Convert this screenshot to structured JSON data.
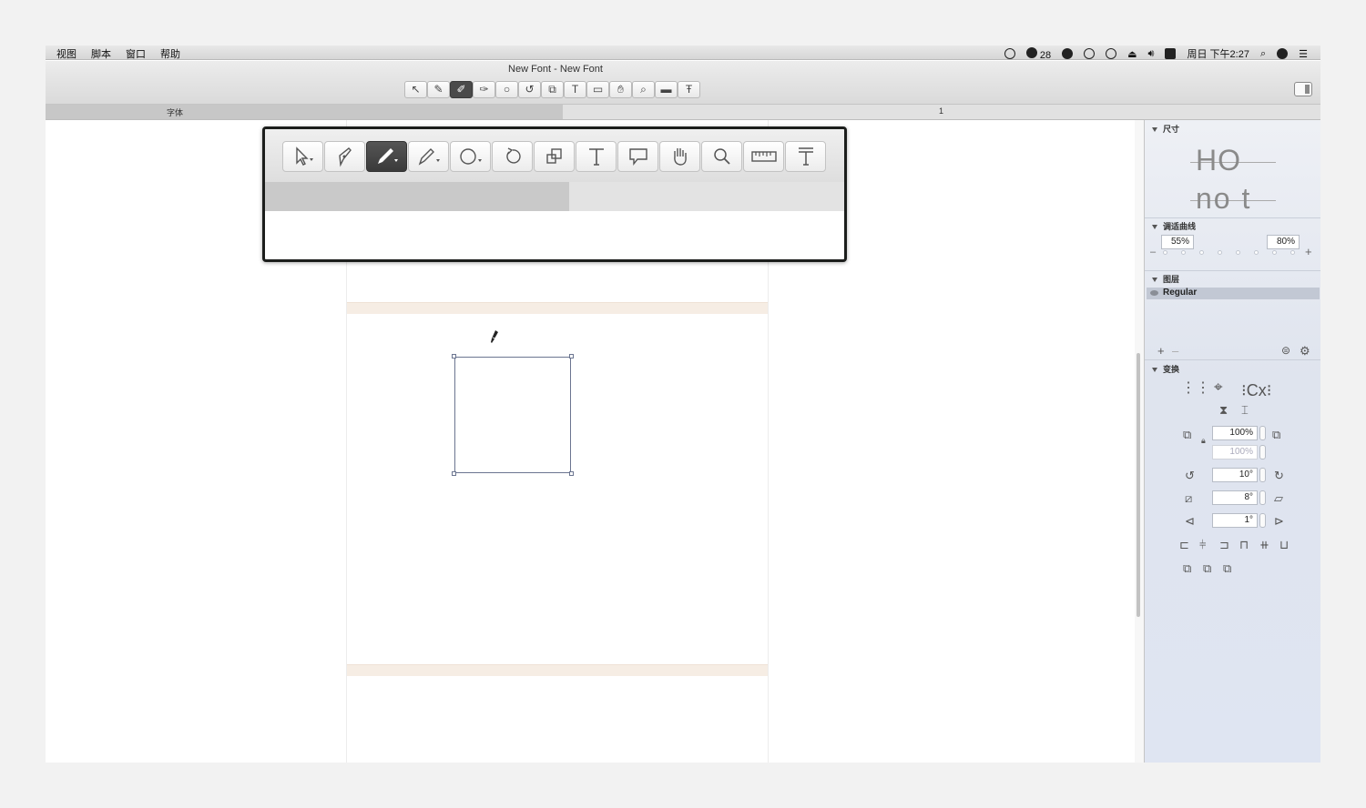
{
  "menubar": {
    "menus": [
      "视图",
      "脚本",
      "窗口",
      "帮助"
    ],
    "notification_count": "28",
    "clock": "周日 下午2:27"
  },
  "window": {
    "title": "New Font - New Font"
  },
  "toolbar": {
    "tools": [
      {
        "icon": "select-arrow-icon"
      },
      {
        "icon": "draw-pen-icon"
      },
      {
        "icon": "pencil-brush-icon",
        "active": true
      },
      {
        "icon": "calligraphy-pen-icon"
      },
      {
        "icon": "shape-circle-icon"
      },
      {
        "icon": "rotate-icon"
      },
      {
        "icon": "scale-icon"
      },
      {
        "icon": "text-tool-icon"
      },
      {
        "icon": "annotation-bubble-icon"
      },
      {
        "icon": "hand-icon"
      },
      {
        "icon": "zoom-icon"
      },
      {
        "icon": "measure-ruler-icon"
      },
      {
        "icon": "metrics-text-icon"
      }
    ]
  },
  "tabs": {
    "font_tab": "字体",
    "glyph_tab": "1"
  },
  "inspector": {
    "dimensions": {
      "title": "尺寸",
      "preview_line1": "HO",
      "preview_line2": "no t"
    },
    "fit_curve": {
      "title": "调适曲线",
      "left_value": "55%",
      "right_value": "80%"
    },
    "layers": {
      "title": "图层",
      "items": [
        "Regular"
      ]
    },
    "transform": {
      "title": "变换",
      "cx_label": "Cx",
      "scale_x": "100%",
      "scale_y": "100%",
      "rotate": "10°",
      "slant": "8°",
      "skew": "1°"
    }
  },
  "colors": {
    "menubar_bg": "#dedede",
    "active_tool": "#444444",
    "metric_band": "#f6ede4",
    "path_stroke": "#6b7590",
    "inspector_bg": "#e2e7f0",
    "layer_selected": "#c2c8d4"
  }
}
